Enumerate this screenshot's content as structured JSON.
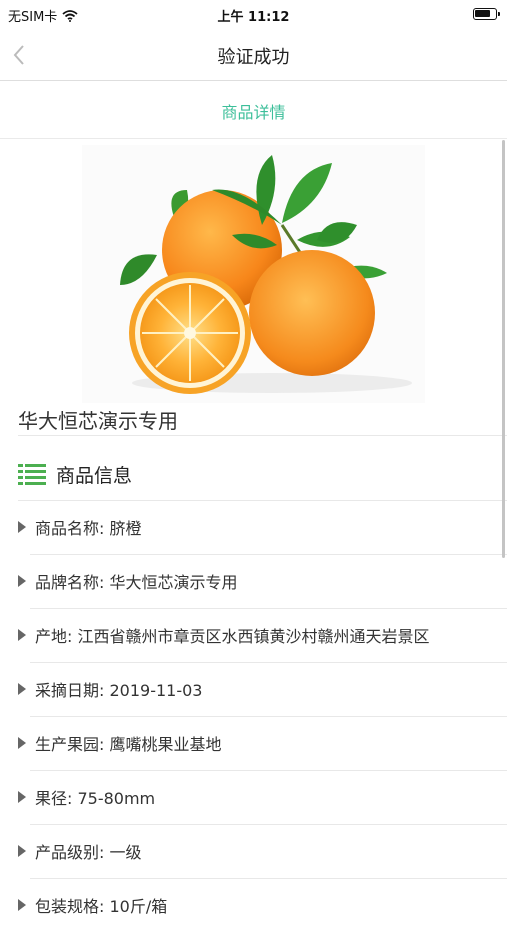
{
  "status": {
    "carrier": "无SIM卡",
    "time": "上午 11:12"
  },
  "nav": {
    "title": "验证成功"
  },
  "tab": {
    "label": "商品详情"
  },
  "product": {
    "name": "华大恒芯演示专用"
  },
  "section": {
    "title": "商品信息"
  },
  "info": [
    {
      "text": "商品名称: 脐橙"
    },
    {
      "text": "品牌名称: 华大恒芯演示专用"
    },
    {
      "text": "产地: 江西省赣州市章贡区水西镇黄沙村赣州通天岩景区"
    },
    {
      "text": "采摘日期: 2019-11-03"
    },
    {
      "text": "生产果园: 鹰嘴桃果业基地"
    },
    {
      "text": "果径: 75-80mm"
    },
    {
      "text": "产品级别: 一级"
    },
    {
      "text": "包装规格: 10斤/箱"
    }
  ],
  "colors": {
    "accent": "#3dbf9a",
    "list_icon": "#4caf50"
  }
}
